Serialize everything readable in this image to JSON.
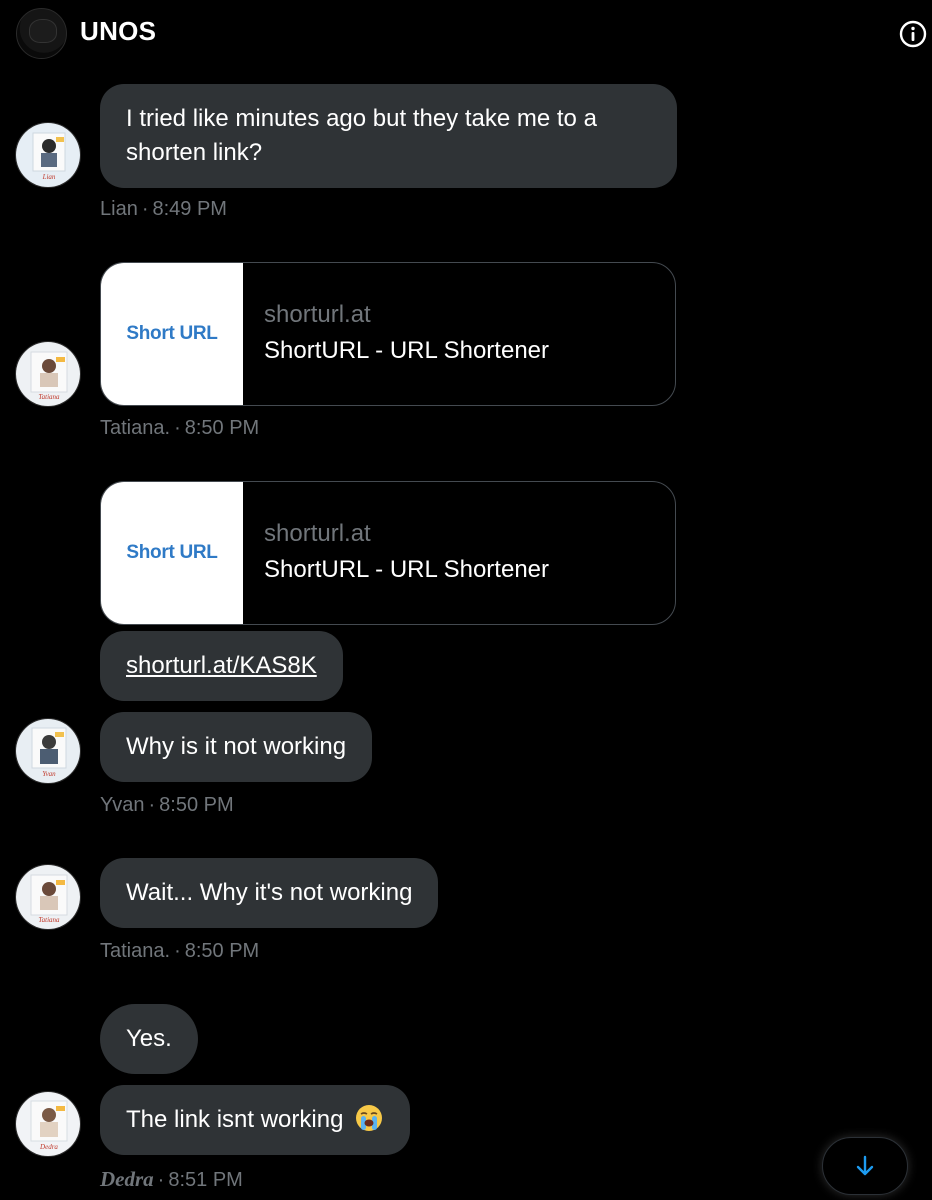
{
  "header": {
    "title": "UNOS",
    "info_icon": "info-circle-icon"
  },
  "messages": [
    {
      "type": "text",
      "text": "I tried like minutes ago but they take me to a shorten link?",
      "sender": "Lian",
      "time": "8:49 PM"
    },
    {
      "type": "card",
      "thumb_text": "Short URL",
      "domain": "shorturl.at",
      "title": "ShortURL - URL Shortener",
      "sender": "Tatiana.",
      "time": "8:50 PM"
    },
    {
      "type": "card",
      "thumb_text": "Short URL",
      "domain": "shorturl.at",
      "title": "ShortURL - URL Shortener"
    },
    {
      "type": "link",
      "text": "shorturl.at/KAS8K"
    },
    {
      "type": "text",
      "text": "Why is it not working",
      "sender": "Yvan",
      "time": "8:50 PM"
    },
    {
      "type": "text",
      "text": "Wait... Why it's not working",
      "sender": "Tatiana.",
      "time": "8:50 PM"
    },
    {
      "type": "text",
      "text": "Yes."
    },
    {
      "type": "text",
      "text": "The link isnt working",
      "emoji": "loudly-crying-face",
      "sender": "Dedra",
      "time": "8:51 PM"
    }
  ],
  "meta_separator": "·",
  "scroll_button": {
    "icon": "arrow-down-icon"
  },
  "colors": {
    "background": "#000000",
    "bubble": "#2f3336",
    "meta_text": "#71767b",
    "accent": "#1d9bf0",
    "link_thumb_text": "#2f7ac6"
  }
}
